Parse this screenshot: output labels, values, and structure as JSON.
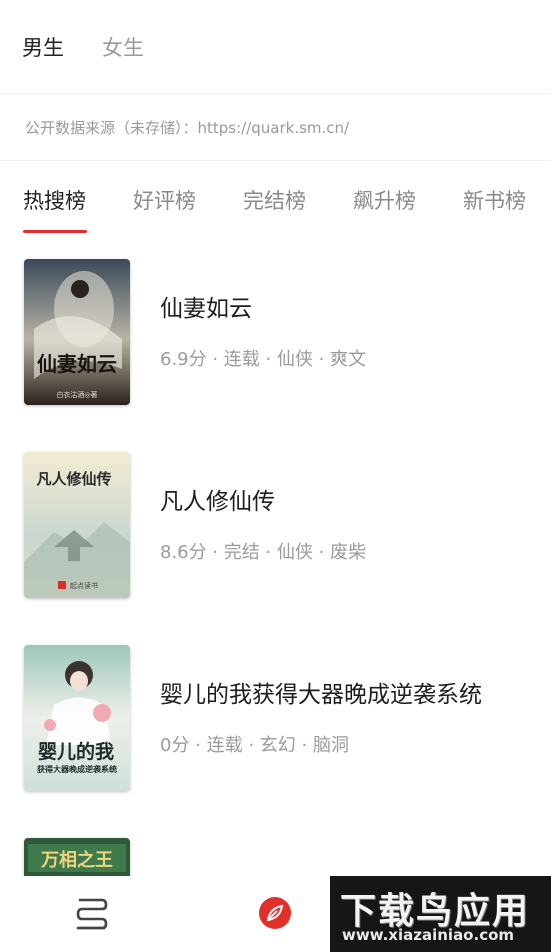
{
  "gender_tabs": [
    {
      "label": "男生",
      "active": true
    },
    {
      "label": "女生",
      "active": false
    }
  ],
  "source_notice": "公开数据来源（未存储）：https://quark.sm.cn/",
  "rank_tabs": [
    {
      "label": "热搜榜",
      "active": true
    },
    {
      "label": "好评榜",
      "active": false
    },
    {
      "label": "完结榜",
      "active": false
    },
    {
      "label": "飙升榜",
      "active": false
    },
    {
      "label": "新书榜",
      "active": false
    }
  ],
  "books": [
    {
      "title": "仙妻如云",
      "meta": "6.9分 · 连载 · 仙侠 · 爽文",
      "cover_text": "仙妻如云",
      "cover_author": "白衣沽酒◎著"
    },
    {
      "title": "凡人修仙传",
      "meta": "8.6分 · 完结 · 仙侠 · 废柴",
      "cover_text": "凡人修仙传",
      "cover_badge": "起点读书"
    },
    {
      "title": "婴儿的我获得大器晚成逆袭系统",
      "meta": "0分 · 连载 · 玄幻 · 脑洞",
      "cover_text": "婴儿的我",
      "cover_subtext": "获得大器晚成逆袭系统"
    },
    {
      "title": "",
      "meta": "",
      "cover_text": "万相之王"
    }
  ],
  "bottom_nav": [
    {
      "icon": "bookshelf-icon",
      "active": false
    },
    {
      "icon": "compass-leaf-icon",
      "active": true
    }
  ],
  "watermark": {
    "main": "下载鸟应用",
    "url": "www.xiazainiao.com"
  },
  "colors": {
    "accent": "#e1302a",
    "text_primary": "#222222",
    "text_secondary": "#9b9b9b"
  }
}
